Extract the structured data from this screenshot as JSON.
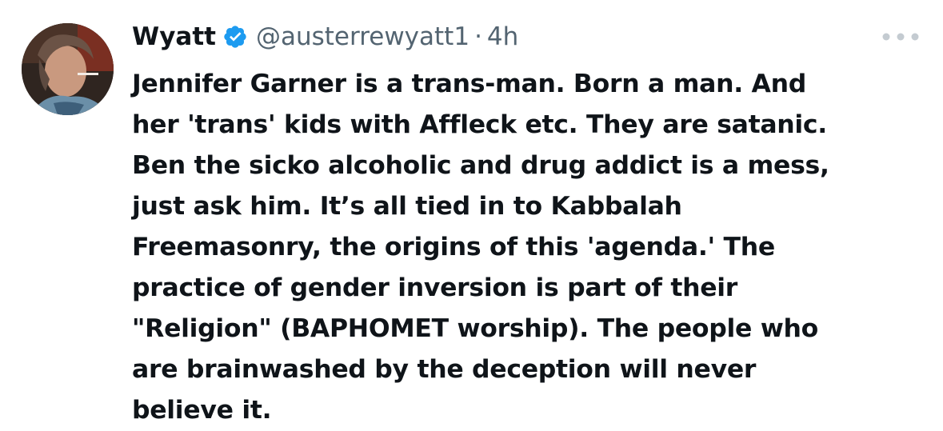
{
  "tweet": {
    "author_name": "Wyatt",
    "author_handle": "@austerrewyatt1",
    "separator": "·",
    "timestamp": "4h",
    "verified_icon": "verified-badge-icon",
    "more_icon": "more-options-icon",
    "body_lines": [
      "Jennifer Garner is a trans-man. Born a man. And",
      "her 'trans' kids with Affleck etc. They are satanic.",
      "Ben the sicko alcoholic and drug addict is a mess,",
      "just ask him. It’s all tied in to Kabbalah",
      "Freemasonry, the origins of this 'agenda.' The",
      "practice of gender inversion is part of their",
      "\"Religion\" (BAPHOMET worship). The people who",
      "are brainwashed by the deception will never",
      "believe it."
    ]
  },
  "colors": {
    "text_primary": "#0f1419",
    "text_secondary": "#536471",
    "verified_blue": "#1d9bf0",
    "background": "#ffffff"
  }
}
